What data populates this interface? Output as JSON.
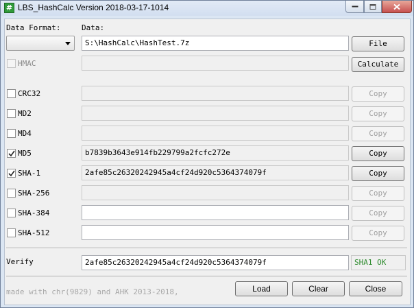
{
  "window": {
    "title": "LBS_HashCalc Version 2018-03-17-1014",
    "icon": "hash-icon"
  },
  "header": {
    "data_format_label": "Data Format:",
    "data_label": "Data:",
    "data_format_value": "",
    "data_value": "S:\\HashCalc\\HashTest.7z",
    "file_button": "File",
    "calculate_button": "Calculate"
  },
  "hmac": {
    "label": "HMAC",
    "checked": false,
    "value": ""
  },
  "hashes": [
    {
      "label": "CRC32",
      "checked": false,
      "value": "",
      "copy": "Copy",
      "enabled": false
    },
    {
      "label": "MD2",
      "checked": false,
      "value": "",
      "copy": "Copy",
      "enabled": false
    },
    {
      "label": "MD4",
      "checked": false,
      "value": "",
      "copy": "Copy",
      "enabled": false
    },
    {
      "label": "MD5",
      "checked": true,
      "value": "b7839b3643e914fb229799a2fcfc272e",
      "copy": "Copy",
      "enabled": true
    },
    {
      "label": "SHA-1",
      "checked": true,
      "value": "2afe85c26320242945a4cf24d920c5364374079f",
      "copy": "Copy",
      "enabled": true
    },
    {
      "label": "SHA-256",
      "checked": false,
      "value": "",
      "copy": "Copy",
      "enabled": false
    },
    {
      "label": "SHA-384",
      "checked": false,
      "value": "",
      "copy": "Copy",
      "enabled": false
    },
    {
      "label": "SHA-512",
      "checked": false,
      "value": "",
      "copy": "Copy",
      "enabled": false
    }
  ],
  "verify": {
    "label": "Verify",
    "value": "2afe85c26320242945a4cf24d920c5364374079f",
    "result": "SHA1 OK",
    "result_color": "#2e8b2e"
  },
  "footer": {
    "credit": "made with chr(9829) and AHK 2013-2018,",
    "load_button": "Load",
    "clear_button": "Clear",
    "close_button": "Close"
  }
}
